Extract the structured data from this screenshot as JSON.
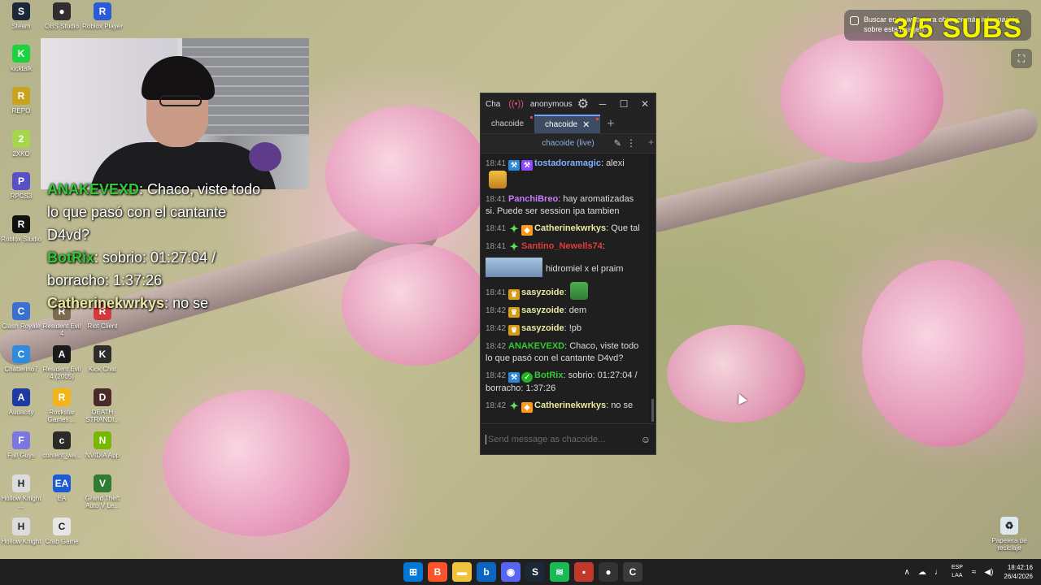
{
  "desktop_icons": [
    {
      "label": "Steam",
      "color": "#1b2838",
      "glyph": "S"
    },
    {
      "label": "OBS Studio",
      "color": "#302e31",
      "glyph": "●"
    },
    {
      "label": "Roblox Player",
      "color": "#2b5bd6",
      "glyph": "R"
    },
    {
      "label": "kicktalk",
      "color": "#1ad33f",
      "glyph": "K"
    },
    {
      "label": "REPO",
      "color": "#c9a31f",
      "glyph": "R"
    },
    {
      "label": "2XKO",
      "color": "#a6d64b",
      "glyph": "2"
    },
    {
      "label": "RPCS3",
      "color": "#5850c9",
      "glyph": "P"
    },
    {
      "label": "Roblox Studio",
      "color": "#111",
      "glyph": "R"
    },
    {
      "label": "Clash Royale",
      "color": "#3b6fd1",
      "glyph": "C"
    },
    {
      "label": "Resident Evil 4",
      "color": "#7a6a50",
      "glyph": "R"
    },
    {
      "label": "Riot Client",
      "color": "#d43a3a",
      "glyph": "R"
    },
    {
      "label": "Chatterino7",
      "color": "#2f8bde",
      "glyph": "C"
    },
    {
      "label": "Resident Evil 4 (2005)",
      "color": "#1a1a1a",
      "glyph": "A"
    },
    {
      "label": "Kick Chat",
      "color": "#2d2d2d",
      "glyph": "K"
    },
    {
      "label": "Audacity",
      "color": "#1d3ba3",
      "glyph": "A"
    },
    {
      "label": "Rockstar Games ...",
      "color": "#f3b41b",
      "glyph": "R"
    },
    {
      "label": "DEATH STRANDI...",
      "color": "#4a2a2a",
      "glyph": "D"
    },
    {
      "label": "Fall Guys",
      "color": "#7c77e0",
      "glyph": "F"
    },
    {
      "label": "content_wa...",
      "color": "#2a2a2a",
      "glyph": "c"
    },
    {
      "label": "NVIDIA App",
      "color": "#76b900",
      "glyph": "N"
    },
    {
      "label": "Hollow Knight ...",
      "color": "#dcdcdc",
      "glyph": "H"
    },
    {
      "label": "EA",
      "color": "#1d5ad6",
      "glyph": "EA"
    },
    {
      "label": "Grand Theft Auto V Le...",
      "color": "#2e7d32",
      "glyph": "V"
    },
    {
      "label": "Hollow Knight",
      "color": "#dcdcdc",
      "glyph": "H"
    },
    {
      "label": "Crab Game",
      "color": "#e6e6e6",
      "glyph": "C"
    },
    {
      "label": "Papelera de reciclaje",
      "color": "#dce8ee",
      "glyph": "♻"
    }
  ],
  "overlay_chat": [
    {
      "user": "ANAKEVEXD",
      "text": ": Chaco, viste todo",
      "color": "#34c934"
    },
    {
      "user": "",
      "text": "lo que pasó con el cantante",
      "color": "#ffffff"
    },
    {
      "user": "",
      "text": "D4vd?",
      "color": "#ffffff"
    },
    {
      "user": "BotRix",
      "text": ": sobrio: 01:27:04 /",
      "color": "#34c934"
    },
    {
      "user": "",
      "text": "borracho: 1:37:26",
      "color": "#ffffff"
    },
    {
      "user": "Catherinekwrkys",
      "text": ": no se",
      "color": "#e9e9a0"
    }
  ],
  "subs_counter": "3/5 SUBS",
  "lens_tip": "Buscar en la web para obtener más información sobre esta imagen",
  "chatterino": {
    "title": "Cha",
    "user": "anonymous",
    "tabs": [
      {
        "label": "chacoide",
        "active": false
      },
      {
        "label": "chacoide",
        "active": true
      }
    ],
    "channel_header": "chacoide (live)",
    "input_placeholder": "Send message as chacoide...",
    "messages": [
      {
        "time": "18:41",
        "user": "tostadoramagic",
        "text": ": alexi",
        "color": "#7fb2ff"
      },
      {
        "time": "18:41",
        "user": "PanchiBreo",
        "text": ": hay aromatizadas si. Puede ser session ipa tambien",
        "color": "#c77cff"
      },
      {
        "time": "18:41",
        "user": "Catherinekwrkys",
        "text": ": Que tal",
        "color": "#e9e9a0"
      },
      {
        "time": "18:41",
        "user": "Santino_Newells74",
        "text": ":",
        "color": "#e03c3c"
      },
      {
        "time": "",
        "user": "",
        "text": "hidromiel x el praim",
        "color": "#ddd"
      },
      {
        "time": "18:41",
        "user": "sasyzoide",
        "text": ":",
        "color": "#e9e9a0"
      },
      {
        "time": "18:42",
        "user": "sasyzoide",
        "text": ": dem",
        "color": "#e9e9a0"
      },
      {
        "time": "18:42",
        "user": "sasyzoide",
        "text": ": !pb",
        "color": "#e9e9a0"
      },
      {
        "time": "18:42",
        "user": "ANAKEVEXD",
        "text": ": Chaco, viste todo lo que pasó con el cantante D4vd?",
        "color": "#34c934"
      },
      {
        "time": "18:42",
        "user": "BotRix",
        "text": ": sobrio: 01:27:04 / borracho: 1:37:26",
        "color": "#34c934"
      },
      {
        "time": "18:42",
        "user": "Catherinekwrkys",
        "text": ": no se",
        "color": "#e9e9a0"
      }
    ]
  },
  "tray": {
    "lang_top": "ESP",
    "lang_bottom": "LAA",
    "time": "18:42:16",
    "date": "26/4/2026"
  }
}
